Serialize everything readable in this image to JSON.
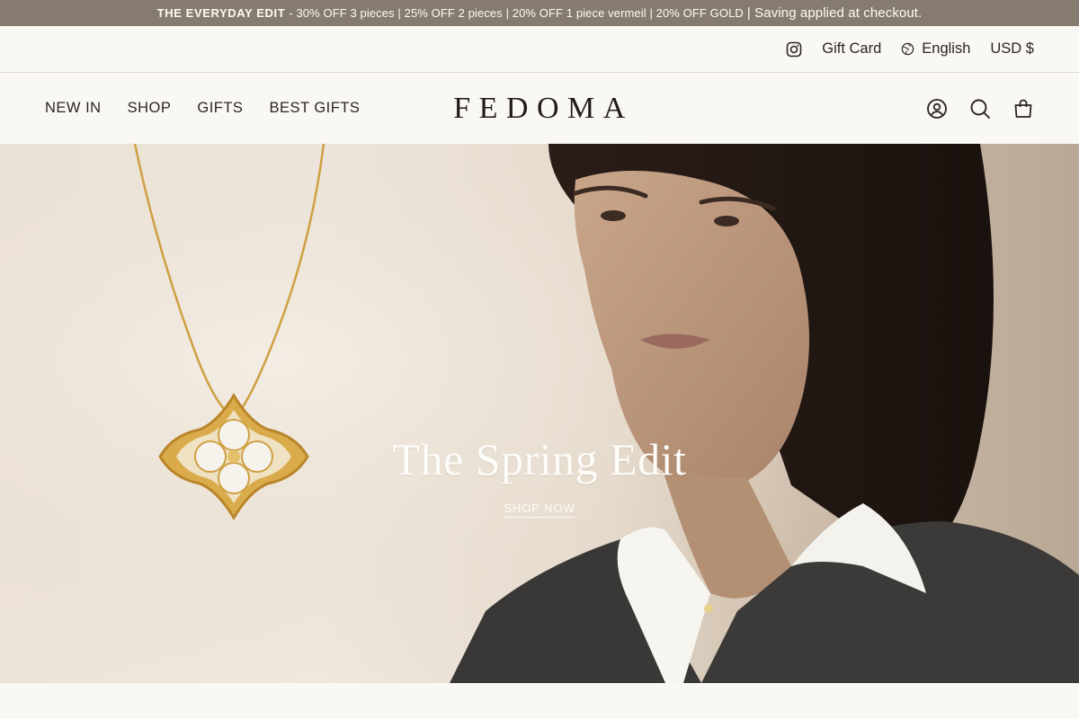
{
  "announcement": {
    "bold": "THE EVERYDAY EDIT",
    "text": " - 30% OFF 3 pieces | 25% OFF 2 pieces | 20% OFF 1 piece vermeil | 20% OFF GOLD",
    "tail": "| Saving applied at checkout."
  },
  "utility": {
    "instagram_icon": "instagram-icon",
    "gift_card": "Gift Card",
    "language": "English",
    "currency": "USD $"
  },
  "nav": {
    "items": [
      "NEW IN",
      "SHOP",
      "GIFTS",
      "BEST GIFTS"
    ],
    "logo": "FEDOMA",
    "icons": [
      "account-icon",
      "search-icon",
      "bag-icon"
    ]
  },
  "hero": {
    "title": "The Spring Edit",
    "cta": "SHOP NOW"
  },
  "colors": {
    "announcement_bg": "#857c6f",
    "page_bg": "#faf8f4",
    "text": "#2a2622",
    "gold": "#d4a640"
  }
}
